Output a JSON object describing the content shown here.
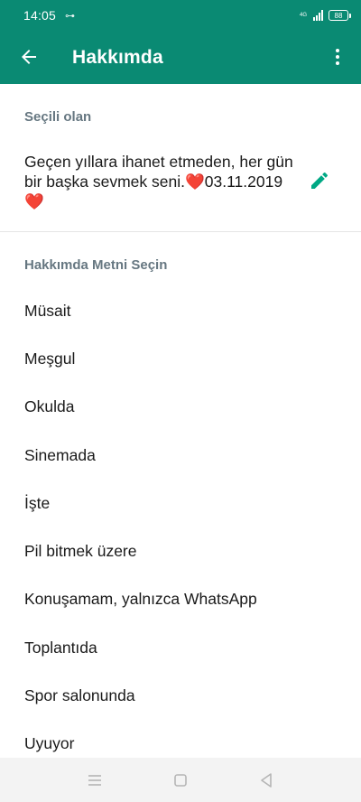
{
  "status_bar": {
    "time": "14:05",
    "key_symbol": "⊶",
    "network": "4G",
    "battery": "88"
  },
  "app_bar": {
    "title": "Hakkımda"
  },
  "current": {
    "section_label": "Seçili olan",
    "about_text": "Geçen yıllara ihanet etmeden, her gün bir başka sevmek seni.❤️03.11.2019 ❤️"
  },
  "choices": {
    "section_label": "Hakkımda Metni Seçin",
    "options": [
      "Müsait",
      "Meşgul",
      "Okulda",
      "Sinemada",
      "İşte",
      "Pil bitmek üzere",
      "Konuşamam, yalnızca WhatsApp",
      "Toplantıda",
      "Spor salonunda",
      "Uyuyor"
    ]
  },
  "colors": {
    "brand": "#0a8a73",
    "accent": "#00a884",
    "section_label": "#667781"
  },
  "icons": {
    "back": "arrow-left-icon",
    "more": "more-vert-icon",
    "edit": "pencil-icon"
  }
}
